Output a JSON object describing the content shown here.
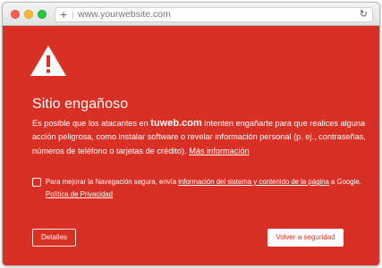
{
  "browser": {
    "url": "www.yourwebsite.com",
    "new_tab_symbol": "+",
    "reload_symbol": "↻"
  },
  "page": {
    "title": "Sitio engañoso",
    "intro_before_domain": "Es posible que los atacantes en ",
    "domain": "tuweb.com",
    "intro_after_domain": " intenten engañarte para que realices alguna acción peligrosa, como instalar software o revelar información personal (p. ej., contraseñas, números de teléfono o tarjetas de crédito). ",
    "more_info_link": "Más información",
    "consent_before_link": "Para mejorar la Navegación segura, envía ",
    "consent_link": "información del sistema y contenido de la página",
    "consent_middle": " a Google. ",
    "privacy_link": "Política de Privacidad",
    "details_button": "Detalles",
    "back_button": "Volver a seguridad"
  },
  "colors": {
    "background": "#d93025",
    "text": "#ffffff"
  },
  "icons": {
    "warning": "warning-triangle-icon",
    "new_tab": "plus-icon",
    "reload": "reload-icon"
  }
}
